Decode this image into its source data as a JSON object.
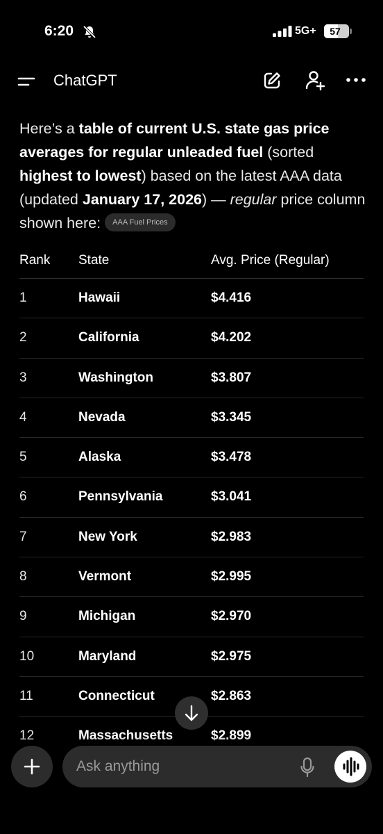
{
  "status": {
    "time": "6:20",
    "network": "5G+",
    "battery": "57"
  },
  "nav": {
    "title": "ChatGPT"
  },
  "intro": {
    "p1": "Here’s a ",
    "b1": "table of current U.S. state gas price averages for regular unleaded fuel",
    "p2": " (sorted ",
    "b2": "highest to lowest",
    "p3": ") based on the latest AAA data (updated ",
    "b3": "January 17, 2026",
    "p4": ") — ",
    "i1": "regular",
    "p5": " price column shown here:",
    "chip": "AAA Fuel Prices"
  },
  "table": {
    "headers": [
      "Rank",
      "State",
      "Avg. Price (Regular)"
    ],
    "rows": [
      {
        "rank": "1",
        "state": "Hawaii",
        "price": "$4.416"
      },
      {
        "rank": "2",
        "state": "California",
        "price": "$4.202"
      },
      {
        "rank": "3",
        "state": "Washington",
        "price": "$3.807"
      },
      {
        "rank": "4",
        "state": "Nevada",
        "price": "$3.345"
      },
      {
        "rank": "5",
        "state": "Alaska",
        "price": "$3.478"
      },
      {
        "rank": "6",
        "state": "Pennsylvania",
        "price": "$3.041"
      },
      {
        "rank": "7",
        "state": "New York",
        "price": "$2.983"
      },
      {
        "rank": "8",
        "state": "Vermont",
        "price": "$2.995"
      },
      {
        "rank": "9",
        "state": "Michigan",
        "price": "$2.970"
      },
      {
        "rank": "10",
        "state": "Maryland",
        "price": "$2.975"
      },
      {
        "rank": "11",
        "state": "Connecticut",
        "price": "$2.863"
      },
      {
        "rank": "12",
        "state": "Massachusetts",
        "price": "$2.899"
      }
    ]
  },
  "composer": {
    "placeholder": "Ask anything"
  }
}
